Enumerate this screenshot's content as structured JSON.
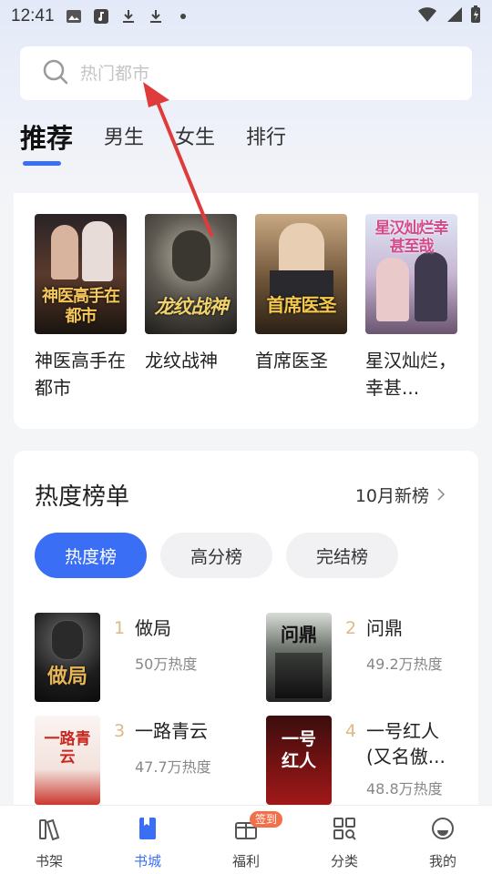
{
  "status_bar": {
    "time": "12:41",
    "icons": [
      "gallery-icon",
      "music-app-icon",
      "download-icon",
      "download-icon",
      "dot-icon"
    ],
    "right_icons": [
      "wifi-icon",
      "signal-icon",
      "battery-icon"
    ]
  },
  "search": {
    "placeholder": "热门都市",
    "icon": "search-icon"
  },
  "tabs": [
    {
      "label": "推荐",
      "active": true
    },
    {
      "label": "男生",
      "active": false
    },
    {
      "label": "女生",
      "active": false
    },
    {
      "label": "排行",
      "active": false
    }
  ],
  "recommended": [
    {
      "title": "神医高手在都市",
      "cover_text": "神医高手在都市"
    },
    {
      "title": "龙纹战神",
      "cover_text": "龙纹战神"
    },
    {
      "title": "首席医圣",
      "cover_text": "首席医圣"
    },
    {
      "title": "星汉灿烂，幸甚...",
      "cover_text": "星汉灿烂幸甚至哉"
    }
  ],
  "rank": {
    "title": "热度榜单",
    "new_label": "10月新榜",
    "pills": [
      {
        "label": "热度榜",
        "active": true
      },
      {
        "label": "高分榜",
        "active": false
      },
      {
        "label": "完结榜",
        "active": false
      }
    ],
    "items": [
      {
        "num": "1",
        "name": "做局",
        "heat": "50万热度",
        "cover_text": "做局"
      },
      {
        "num": "2",
        "name": "问鼎",
        "heat": "49.2万热度",
        "cover_text": "问鼎"
      },
      {
        "num": "3",
        "name": "一路青云",
        "heat": "47.7万热度",
        "cover_text": "一路青云"
      },
      {
        "num": "4",
        "name": "一号红人\n(又名傲...",
        "name_line1": "一号红人",
        "name_line2": "(又名傲...",
        "heat": "48.8万热度",
        "cover_text": "一号红人"
      }
    ]
  },
  "bottom_nav": {
    "items": [
      {
        "label": "书架",
        "icon": "bookshelf-icon",
        "active": false
      },
      {
        "label": "书城",
        "icon": "bookstore-icon",
        "active": true
      },
      {
        "label": "福利",
        "icon": "gift-icon",
        "active": false,
        "badge": "签到"
      },
      {
        "label": "分类",
        "icon": "category-icon",
        "active": false
      },
      {
        "label": "我的",
        "icon": "profile-icon",
        "active": false
      }
    ]
  },
  "colors": {
    "accent": "#3a6ff5",
    "rank_number": "#e0b887",
    "annotation_arrow": "#e03b3b",
    "badge": "#f36f4a"
  }
}
